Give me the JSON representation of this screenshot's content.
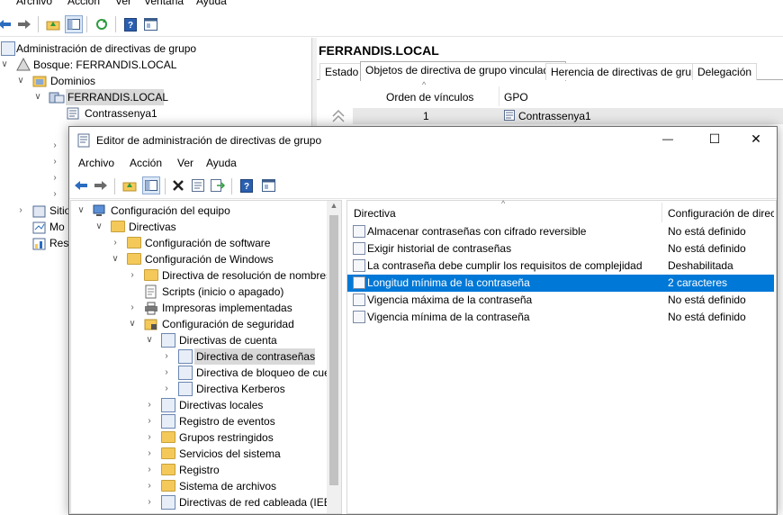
{
  "outer": {
    "menu": [
      "Archivo",
      "Acción",
      "Ver",
      "Ventana",
      "Ayuda"
    ],
    "tree": {
      "root": "Administración de directivas de grupo",
      "forest": "Bosque: FERRANDIS.LOCAL",
      "domains": "Dominios",
      "domain": "FERRANDIS.LOCAL",
      "gpo": "Contrassenya1",
      "sites": "Sitio",
      "modeling": "Mo",
      "results": "Resu"
    },
    "right": {
      "title": "FERRANDIS.LOCAL",
      "tabs": [
        "Estado",
        "Objetos de directiva de grupo vinculados",
        "Herencia de directivas de grupo",
        "Delegación"
      ],
      "columns": [
        "Orden de vínculos",
        "GPO"
      ],
      "rows": [
        {
          "order": "1",
          "gpo": "Contrassenya1"
        }
      ]
    }
  },
  "editor": {
    "title": "Editor de administración de directivas de grupo",
    "controls": {
      "minimize": "—",
      "maximize": "☐",
      "close": "✕"
    },
    "menu": [
      "Archivo",
      "Acción",
      "Ver",
      "Ayuda"
    ],
    "tree": [
      {
        "label": "Configuración del equipo"
      },
      {
        "label": "Directivas"
      },
      {
        "label": "Configuración de software"
      },
      {
        "label": "Configuración de Windows"
      },
      {
        "label": "Directiva de resolución de nombres"
      },
      {
        "label": "Scripts (inicio o apagado)"
      },
      {
        "label": "Impresoras implementadas"
      },
      {
        "label": "Configuración de seguridad"
      },
      {
        "label": "Directivas de cuenta"
      },
      {
        "label": "Directiva de contraseñas"
      },
      {
        "label": "Directiva de bloqueo de cue"
      },
      {
        "label": "Directiva Kerberos"
      },
      {
        "label": "Directivas locales"
      },
      {
        "label": "Registro de eventos"
      },
      {
        "label": "Grupos restringidos"
      },
      {
        "label": "Servicios del sistema"
      },
      {
        "label": "Registro"
      },
      {
        "label": "Sistema de archivos"
      },
      {
        "label": "Directivas de red cableada (IEEE"
      }
    ],
    "list": {
      "col_policy": "Directiva",
      "col_config": "Configuración de direc",
      "rows": [
        {
          "policy": "Almacenar contraseñas con cifrado reversible",
          "value": "No está definido"
        },
        {
          "policy": "Exigir historial de contraseñas",
          "value": "No está definido"
        },
        {
          "policy": "La contraseña debe cumplir los requisitos de complejidad",
          "value": "Deshabilitada"
        },
        {
          "policy": "Longitud mínima de la contraseña",
          "value": "2 caracteres",
          "selected": true
        },
        {
          "policy": "Vigencia máxima de la contraseña",
          "value": "No está definido"
        },
        {
          "policy": "Vigencia mínima de la contraseña",
          "value": "No está definido"
        }
      ]
    }
  },
  "icons": {
    "back": "back-arrow-icon",
    "forward": "forward-arrow-icon",
    "up": "up-folder-icon",
    "show-hide-tree": "console-tree-icon",
    "refresh": "refresh-icon",
    "help": "help-icon",
    "properties": "properties-icon",
    "delete": "delete-icon",
    "export": "export-list-icon"
  },
  "colors": {
    "selection": "#0078d7",
    "accent_blue": "#2a6cc0"
  }
}
